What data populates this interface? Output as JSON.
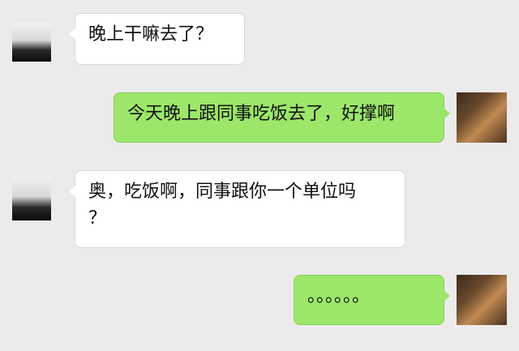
{
  "conversation": {
    "messages": [
      {
        "side": "left",
        "text": "晚上干嘛去了？"
      },
      {
        "side": "right",
        "text": "今天晚上跟同事吃饭去了，好撑啊"
      },
      {
        "side": "left",
        "text": "奥，吃饭啊，同事跟你一个单位吗\n？"
      },
      {
        "side": "right",
        "text": "。。。。。。"
      }
    ]
  },
  "colors": {
    "background": "#ebebeb",
    "incoming_bubble": "#ffffff",
    "outgoing_bubble": "#9ce76a"
  },
  "icons": {
    "contact_avatar": "person-silhouette-avatar",
    "self_avatar": "guitar-avatar"
  }
}
